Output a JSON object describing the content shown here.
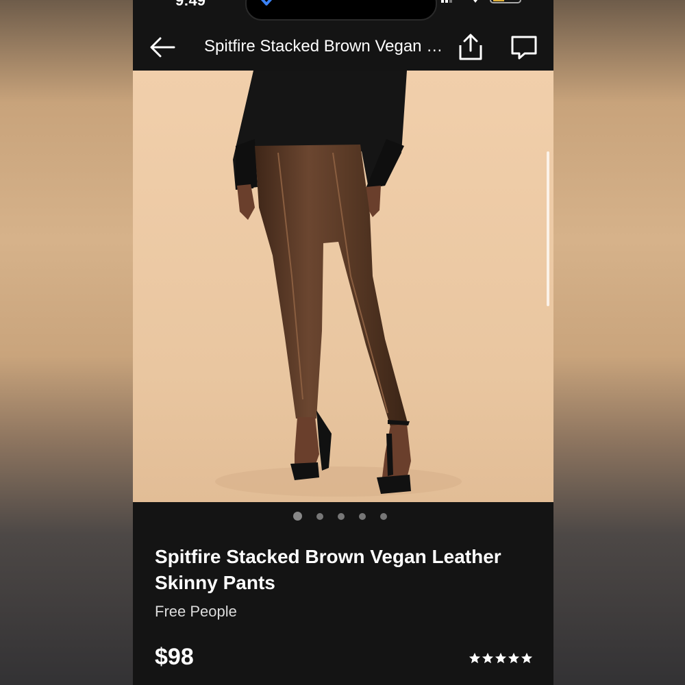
{
  "status": {
    "time": "9:49"
  },
  "nav": {
    "title": "Spitfire Stacked Brown Vegan Leather Skinny Pants",
    "back_icon": "arrow-left-icon",
    "share_icon": "share-icon",
    "chat_icon": "chat-bubble-icon"
  },
  "carousel": {
    "total": 5,
    "active_index": 0
  },
  "product": {
    "name": "Spitfire Stacked Brown Vegan Leather Skinny Pants",
    "brand": "Free People",
    "price": "$98",
    "rating_stars": 5,
    "rating_max": 5
  },
  "colors": {
    "background": "#141414",
    "text": "#ffffff",
    "image_backdrop": "#e9c8a4"
  }
}
